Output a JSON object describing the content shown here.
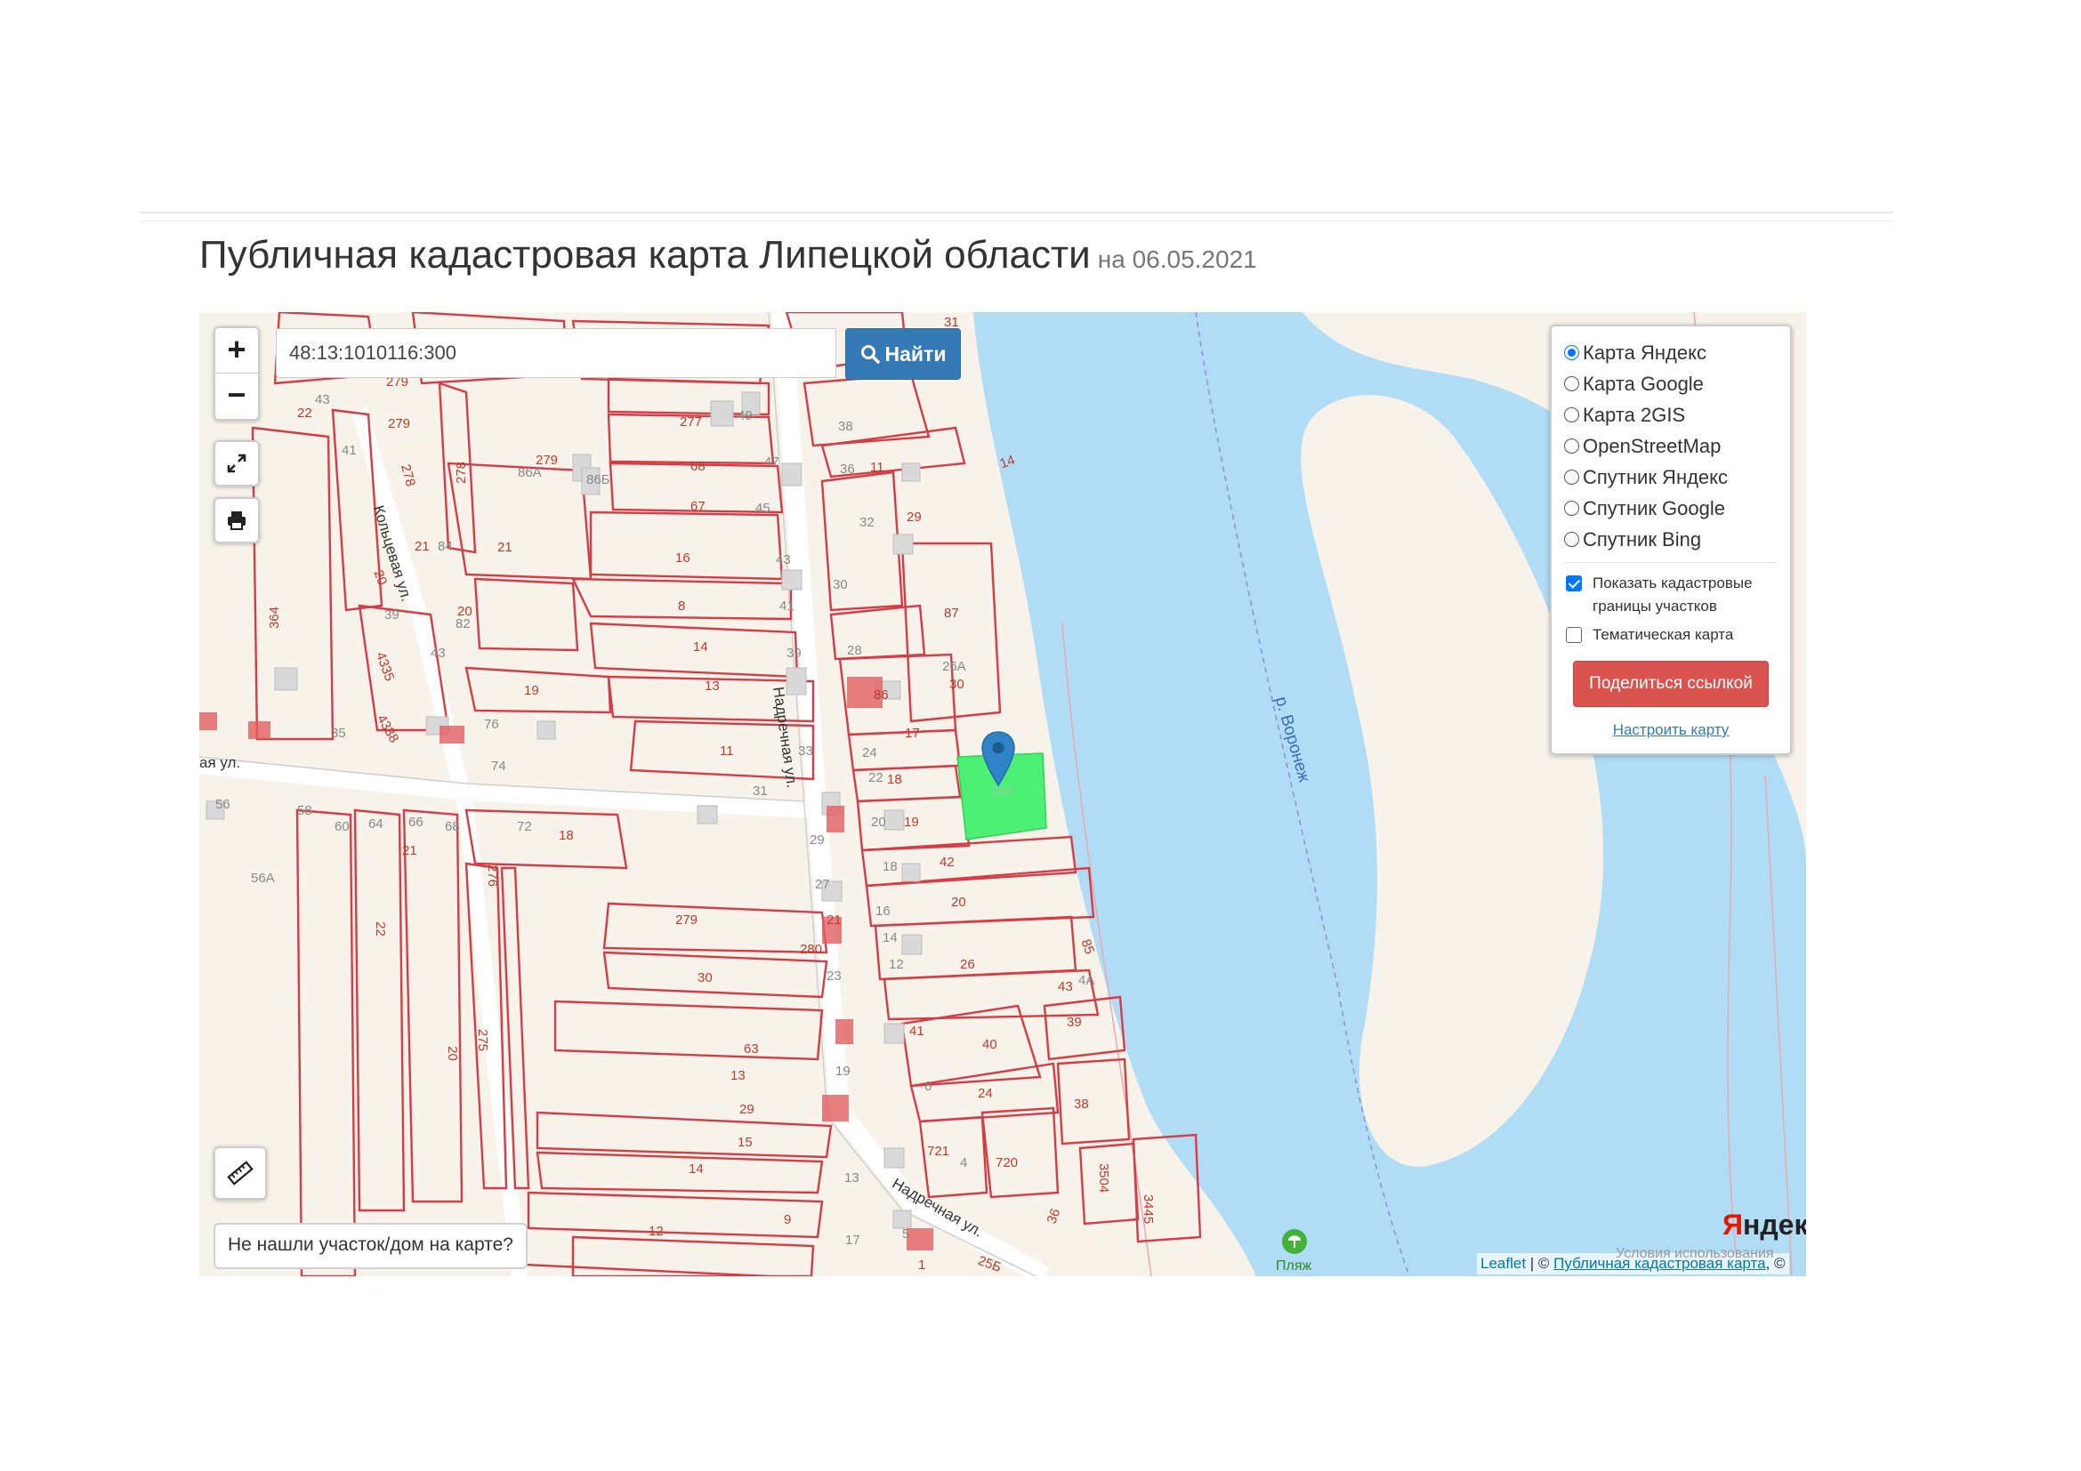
{
  "page": {
    "title": "Публичная кадастровая карта Липецкой области",
    "date": "на 06.05.2021"
  },
  "search": {
    "value": "48:13:1010116:300",
    "button_label": "Найти"
  },
  "controls": {
    "zoom_in": "+",
    "zoom_out": "−",
    "not_found_label": "Не нашли участок/дом на карте?"
  },
  "layers": {
    "base_options": [
      {
        "label": "Карта Яндекс",
        "selected": true
      },
      {
        "label": "Карта Google",
        "selected": false
      },
      {
        "label": "Карта 2GIS",
        "selected": false
      },
      {
        "label": "OpenStreetMap",
        "selected": false
      },
      {
        "label": "Спутник Яндекс",
        "selected": false
      },
      {
        "label": "Спутник Google",
        "selected": false
      },
      {
        "label": "Спутник Bing",
        "selected": false
      }
    ],
    "show_boundaries": {
      "label": "Показать кадастровые границы участков",
      "checked": true
    },
    "thematic": {
      "label": "Тематическая карта",
      "checked": false
    },
    "share_label": "Поделиться ссылкой",
    "configure_label": "Настроить карту"
  },
  "map": {
    "river_label": "р. Воронеж",
    "street_labels": [
      "Надречная ул.",
      "Надречная ул.",
      "Кольцевая ул.",
      "ая ул."
    ],
    "beach_label": "Пляж",
    "selected_parcel": "300",
    "parcel_numbers": [
      "31",
      "277",
      "49",
      "38",
      "68",
      "47",
      "36",
      "11",
      "14",
      "67",
      "45",
      "4",
      "32",
      "29",
      "16",
      "43",
      "30",
      "87",
      "8",
      "41",
      "14",
      "39",
      "28",
      "26А",
      "13",
      "86",
      "30",
      "11",
      "33",
      "24",
      "17",
      "18",
      "22",
      "20",
      "19",
      "31",
      "29",
      "18",
      "42",
      "27",
      "20",
      "279",
      "21",
      "16",
      "280",
      "14",
      "12",
      "26",
      "30",
      "23",
      "43",
      "4А",
      "85",
      "39",
      "63",
      "40",
      "19",
      "41",
      "13",
      "24",
      "6",
      "38",
      "29",
      "15",
      "721",
      "720",
      "4",
      "14",
      "13",
      "3504",
      "12",
      "9",
      "5",
      "17",
      "36",
      "3445",
      "25Б",
      "7",
      "1",
      "23",
      "279",
      "22",
      "43",
      "41",
      "279",
      "278",
      "278",
      "86А",
      "279",
      "86Б",
      "84",
      "21",
      "21",
      "20",
      "39",
      "20",
      "82",
      "364",
      "43",
      "4335",
      "19",
      "35",
      "4338",
      "76",
      "74",
      "56",
      "58",
      "60",
      "64",
      "66",
      "68",
      "72",
      "18",
      "21",
      "56А",
      "276",
      "22",
      "20",
      "275"
    ],
    "yandex_logo_y": "Я",
    "yandex_logo_rest": "ндекс",
    "attribution_leaflet": "Leaflet",
    "attribution_sep": " | © ",
    "attribution_pkk": "Публичная кадастровая карта",
    "attribution_tail": ", ©",
    "attribution_behind": "Условия использования"
  },
  "colors": {
    "parcel_border": "#d63c46",
    "river": "#b1dcf5",
    "selected_parcel": "#4cf075",
    "primary_button": "#337ab7",
    "share_button": "#d9534f",
    "marker": "#2f84c7"
  },
  "icons": {
    "fullscreen": "expand-icon",
    "print": "printer-icon",
    "ruler": "ruler-icon",
    "search": "search-icon",
    "marker": "map-marker-icon",
    "beach": "beach-icon"
  }
}
